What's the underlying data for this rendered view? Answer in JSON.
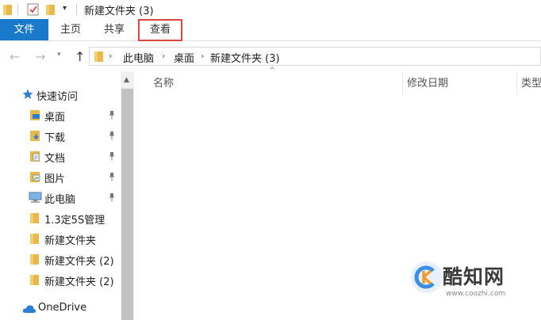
{
  "window": {
    "title": "新建文件夹 (3)"
  },
  "quick_access_toolbar": {
    "dropdown_glyph": "▾"
  },
  "ribbon": {
    "tabs": [
      {
        "label": "文件"
      },
      {
        "label": "主页"
      },
      {
        "label": "共享"
      },
      {
        "label": "查看"
      }
    ],
    "file_tab_color": "#1979ca",
    "highlight_color": "#d9463b"
  },
  "address_bar": {
    "back_glyph": "←",
    "forward_glyph": "→",
    "recent_glyph": "▾",
    "up_glyph": "↑",
    "separator": "›",
    "crumbs": [
      "此电脑",
      "桌面",
      "新建文件夹 (3)"
    ]
  },
  "navigation": {
    "quick_access": "快速访问",
    "items": [
      {
        "label": "桌面",
        "icon": "desktop-folder-icon",
        "pinned": true
      },
      {
        "label": "下载",
        "icon": "download-folder-icon",
        "pinned": true
      },
      {
        "label": "文档",
        "icon": "documents-folder-icon",
        "pinned": true
      },
      {
        "label": "图片",
        "icon": "pictures-folder-icon",
        "pinned": true
      },
      {
        "label": "此电脑",
        "icon": "computer-icon",
        "pinned": true
      },
      {
        "label": "1.3定5S管理",
        "icon": "folder-icon",
        "pinned": false
      },
      {
        "label": "新建文件夹",
        "icon": "folder-icon",
        "pinned": false
      },
      {
        "label": "新建文件夹 (2)",
        "icon": "folder-icon",
        "pinned": false
      },
      {
        "label": "新建文件夹 (2)",
        "icon": "folder-icon",
        "pinned": false
      }
    ],
    "onedrive": "OneDrive"
  },
  "file_list": {
    "sort_glyph": "^",
    "columns": [
      "名称",
      "修改日期",
      "类型"
    ]
  },
  "watermark": {
    "name": "酷知网",
    "url": "www.coozhi.com"
  }
}
